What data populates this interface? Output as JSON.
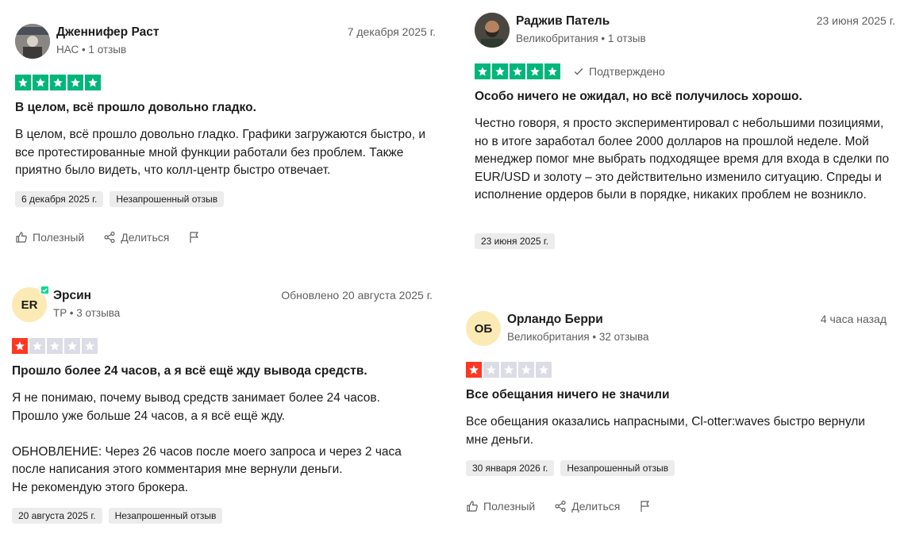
{
  "reviews": [
    {
      "name": "Дженнифер Раст",
      "meta": "НАС • 1 отзыв",
      "date": "7 декабря 2025 г.",
      "rating": 5,
      "title": "В целом, всё прошло довольно гладко.",
      "body": [
        "В целом, всё прошло довольно гладко. Графики загружаются быстро, и все протестированные мной функции работали без проблем. Также приятно было видеть, что колл-центр быстро отвечает."
      ],
      "tags": [
        "6 декабря 2025 г.",
        "Незапрошенный отзыв"
      ]
    },
    {
      "name": "Раджив Патель",
      "meta": "Великобритания • 1 отзыв",
      "date": "23 июня 2025 г.",
      "rating": 5,
      "verified_label": "Подтверждено",
      "title": "Особо ничего не ожидал, но всё получилось хорошо.",
      "body": [
        "Честно говоря, я просто экспериментировал с небольшими позициями, но в итоге заработал более 2000 долларов на прошлой неделе. Мой менеджер помог мне выбрать подходящее время для входа в сделки по EUR/USD и золоту – это действительно изменило ситуацию. Спреды и исполнение ордеров были в порядке, никаких проблем не возникло."
      ],
      "tags": [
        "23 июня 2025 г."
      ]
    },
    {
      "name": "Эрсин",
      "initials": "ER",
      "meta": "TP • 3 отзыва",
      "date": "Обновлено 20 августа 2025 г.",
      "rating": 1,
      "title": "Прошло более 24 часов, а я всё ещё жду вывода средств.",
      "body": [
        "Я не понимаю, почему вывод средств занимает более 24 часов.",
        "Прошло уже больше 24 часов, а я всё ещё жду.",
        "",
        "ОБНОВЛЕНИЕ: Через 26 часов после моего запроса и через 2 часа после написания этого комментария мне вернули деньги.",
        "Не рекомендую этого брокера."
      ],
      "tags": [
        "20 августа 2025 г.",
        "Незапрошенный отзыв"
      ]
    },
    {
      "name": "Орландо Берри",
      "initials": "ОБ",
      "meta": "Великобритания • 32 отзыва",
      "date": "4 часа назад",
      "rating": 1,
      "title": "Все обещания ничего не значили",
      "body": [
        "Все обещания оказались напрасными, Cl-otter:waves быстро вернули мне деньги."
      ],
      "tags": [
        "30 января 2026 г.",
        "Незапрошенный отзыв"
      ]
    }
  ],
  "actions": {
    "useful": "Полезный",
    "share": "Делиться"
  },
  "colors": {
    "star_green": "#00b67a",
    "star_red": "#ff3722",
    "star_empty": "#dcdce6",
    "verified_badge": "#04da8d"
  },
  "icons": [
    "thumbs-up-icon",
    "share-icon",
    "flag-icon",
    "checkmark-icon",
    "star-icon"
  ]
}
